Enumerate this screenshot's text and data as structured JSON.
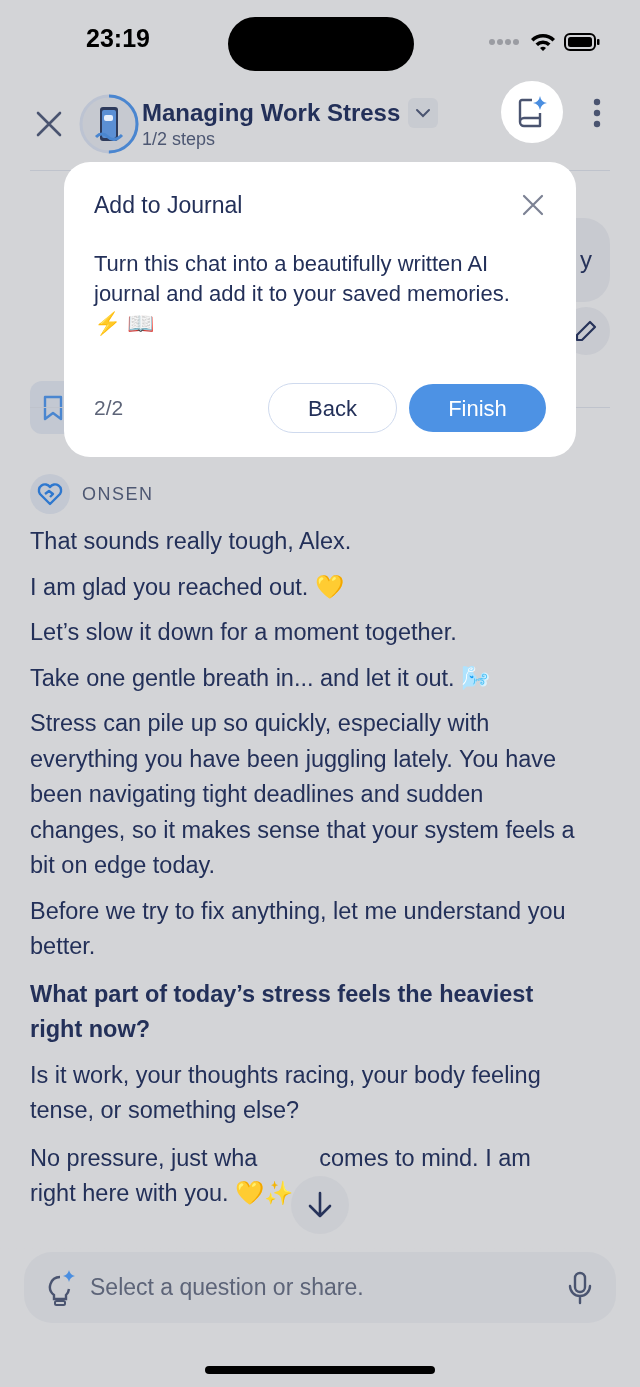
{
  "status_bar": {
    "time": "23:19"
  },
  "header": {
    "title": "Managing Work Stress",
    "subtitle": "1/2 steps"
  },
  "behind_modal": {
    "user_message": "y"
  },
  "modal": {
    "title": "Add to Journal",
    "body": "Turn this chat into a beautifully written AI journal and add it to your saved memories. ⚡ 📖",
    "step": "2/2",
    "buttons": [
      {
        "label": "Back",
        "kind": "secondary"
      },
      {
        "label": "Finish",
        "kind": "primary"
      }
    ]
  },
  "message": {
    "sender": "ONSEN",
    "paragraphs": [
      {
        "kind": "text",
        "text": "That sounds really tough, Alex."
      },
      {
        "kind": "text",
        "text": "I am glad you reached out. 💛"
      },
      {
        "kind": "text",
        "text": "Let’s slow it down for a moment together."
      },
      {
        "kind": "text",
        "text": "Take one gentle breath in... and let it out. 🌬️"
      },
      {
        "kind": "text",
        "text": "Stress can pile up so quickly, especially with everything you have been juggling lately. You have been navigating tight deadlines and sudden changes, so it makes sense that your system feels a bit on edge today."
      },
      {
        "kind": "text",
        "text": "Before we try to fix anything, let me understand you better."
      },
      {
        "kind": "question",
        "text": "What part of today’s stress feels the heaviest right now?"
      },
      {
        "kind": "text",
        "text": "Is it work, your thoughts racing, your body feeling tense, or something else?"
      },
      {
        "kind": "split",
        "parts": [
          "No pressure, just wha",
          "comes to mind. I am",
          "right here with you. 💛✨"
        ]
      }
    ]
  },
  "composer": {
    "placeholder": "Select a question or share."
  }
}
